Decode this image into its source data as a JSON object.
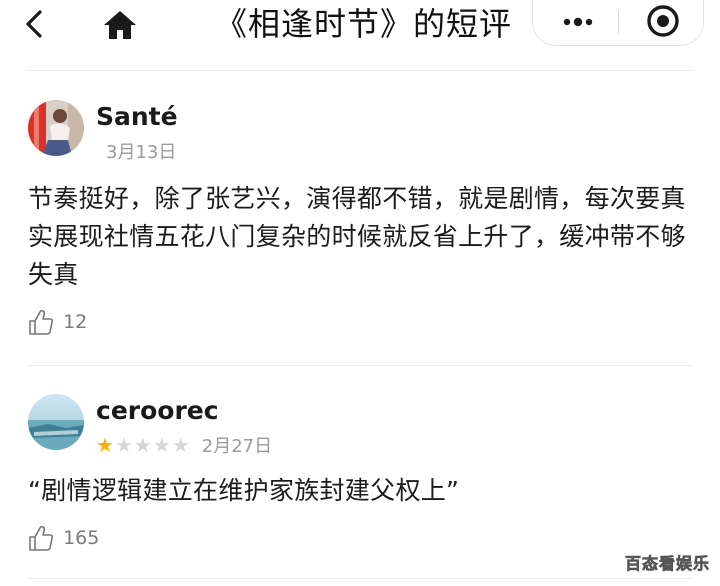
{
  "header": {
    "title": "《相逢时节》的短评",
    "back_icon": "chevron-left-icon",
    "home_icon": "home-icon",
    "more_icon": "more-dots-icon",
    "close_icon": "target-circle-icon"
  },
  "reviews": [
    {
      "username": "Santé",
      "date": "3月13日",
      "rating": null,
      "content": "节奏挺好，除了张艺兴，演得都不错，就是剧情，每次要真实展现社情五花八门复杂的时候就反省上升了，缓冲带不够失真",
      "likes": "12"
    },
    {
      "username": "ceroorec",
      "date": "2月27日",
      "rating": 1,
      "rating_max": 5,
      "content": "“剧情逻辑建立在维护家族封建父权上”",
      "likes": "165"
    }
  ],
  "watermark": "百态看娱乐",
  "colors": {
    "star_filled": "#f5b400",
    "star_empty": "#d6d6d6",
    "meta_gray": "#9a9a9a"
  }
}
